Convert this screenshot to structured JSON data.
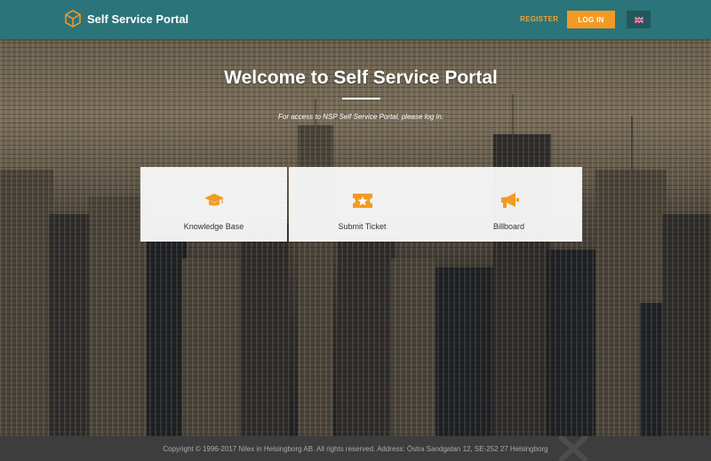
{
  "header": {
    "brand_title": "Self Service Portal",
    "register_label": "REGISTER",
    "login_label": "LOG IN",
    "language_icon": "uk-flag-icon"
  },
  "hero": {
    "title": "Welcome to Self Service Portal",
    "subtitle": "For access to NSP Self Service Portal, please log in."
  },
  "cards": [
    {
      "label": "Knowledge Base",
      "icon": "graduation-cap-icon"
    },
    {
      "label": "Submit Ticket",
      "icon": "ticket-icon"
    },
    {
      "label": "Billboard",
      "icon": "megaphone-icon"
    }
  ],
  "footer": {
    "copyright": "Copyright © 1996-2017 Nilex in Helsingborg AB. All rights reserved. Address: Östra Sandgatan 12, SE-252 27 Helsingborg"
  },
  "colors": {
    "header_bg": "#2b7479",
    "accent": "#f39a25",
    "footer_bg": "#3d3d3d"
  }
}
